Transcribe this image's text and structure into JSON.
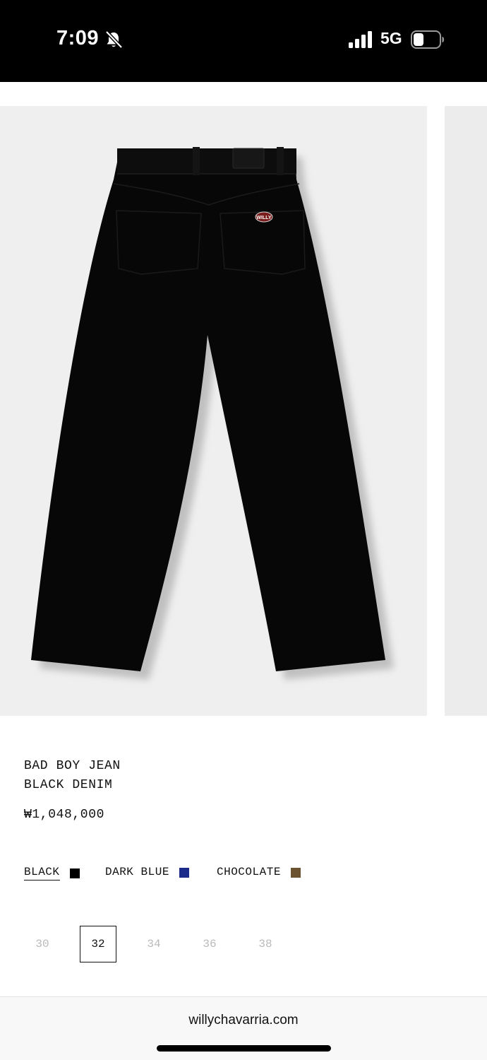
{
  "status_bar": {
    "time": "7:09",
    "network": "5G",
    "icons": [
      "bell-slash-icon",
      "signal-icon",
      "battery-icon"
    ]
  },
  "product": {
    "name_line1": "BAD BOY JEAN",
    "name_line2": "BLACK DENIM",
    "price": "₩1,048,000",
    "patch_text": "WILLY",
    "colors": [
      {
        "label": "BLACK",
        "hex": "#000000",
        "selected": true
      },
      {
        "label": "DARK BLUE",
        "hex": "#1c2a8a",
        "selected": false
      },
      {
        "label": "CHOCOLATE",
        "hex": "#6b5230",
        "selected": false
      }
    ],
    "sizes": [
      {
        "label": "30",
        "selected": false
      },
      {
        "label": "32",
        "selected": true
      },
      {
        "label": "34",
        "selected": false
      },
      {
        "label": "36",
        "selected": false
      },
      {
        "label": "38",
        "selected": false
      }
    ]
  },
  "browser": {
    "url": "willychavarria.com"
  }
}
